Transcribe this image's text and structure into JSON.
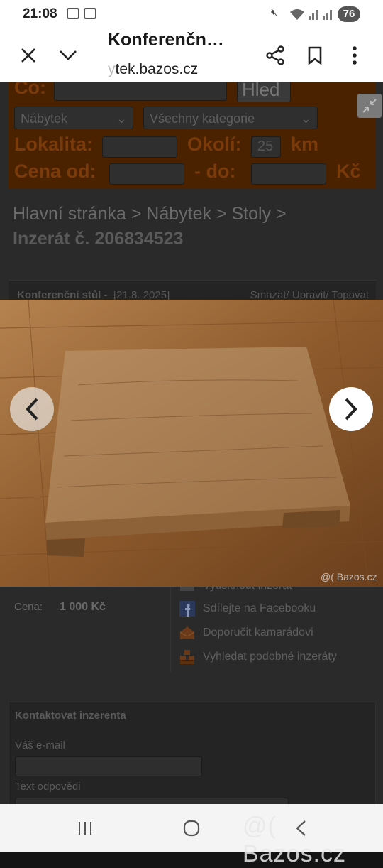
{
  "status_bar": {
    "time": "21:08",
    "battery": "76"
  },
  "toolbar": {
    "title": "Konferenčn…",
    "url_faded": "y",
    "url": "tek.bazos.cz"
  },
  "search": {
    "co_label": "Co:",
    "search_button": "Hled",
    "category_select": "Nábytek",
    "subcategory_select": "Všechny kategorie",
    "locality_label": "Lokalita:",
    "radius_label": "Okolí:",
    "radius_value": "25",
    "radius_unit": "km",
    "price_from_label": "Cena od:",
    "price_to_label": "- do:",
    "currency": "Kč"
  },
  "breadcrumb": {
    "path": "Hlavní stránka > Nábytek > Stoly >",
    "listing": "Inzerát č. 206834523"
  },
  "listing": {
    "title": "Konferenční stůl -",
    "date": "[21.8. 2025]",
    "actions": "Smazat/ Upravit/ Topovat",
    "price_label": "Cena:",
    "price_value": "1 000 Kč",
    "print_label": "Vytisknout inzerát",
    "share_label": "Sdílejte na Facebooku",
    "recommend_label": "Doporučit kamarádovi",
    "similar_label": "Vyhledat podobné inzeráty"
  },
  "photo": {
    "watermark": "@( Bazos.cz",
    "overlay_watermark": "@( Bazos.cz"
  },
  "contact": {
    "heading": "Kontaktovat inzerenta",
    "email_label": "Váš e-mail",
    "reply_label": "Text odpovědi"
  },
  "icons": {
    "close": "close-icon",
    "dropdown": "chevron-down-icon",
    "share": "share-icon",
    "bookmark": "bookmark-icon",
    "menu": "more-vert-icon",
    "prev": "chevron-left-icon",
    "next": "chevron-right-icon",
    "shrink": "shrink-icon"
  },
  "colors": {
    "search_bg": "#4a2200",
    "search_text": "#7a3a0a"
  }
}
